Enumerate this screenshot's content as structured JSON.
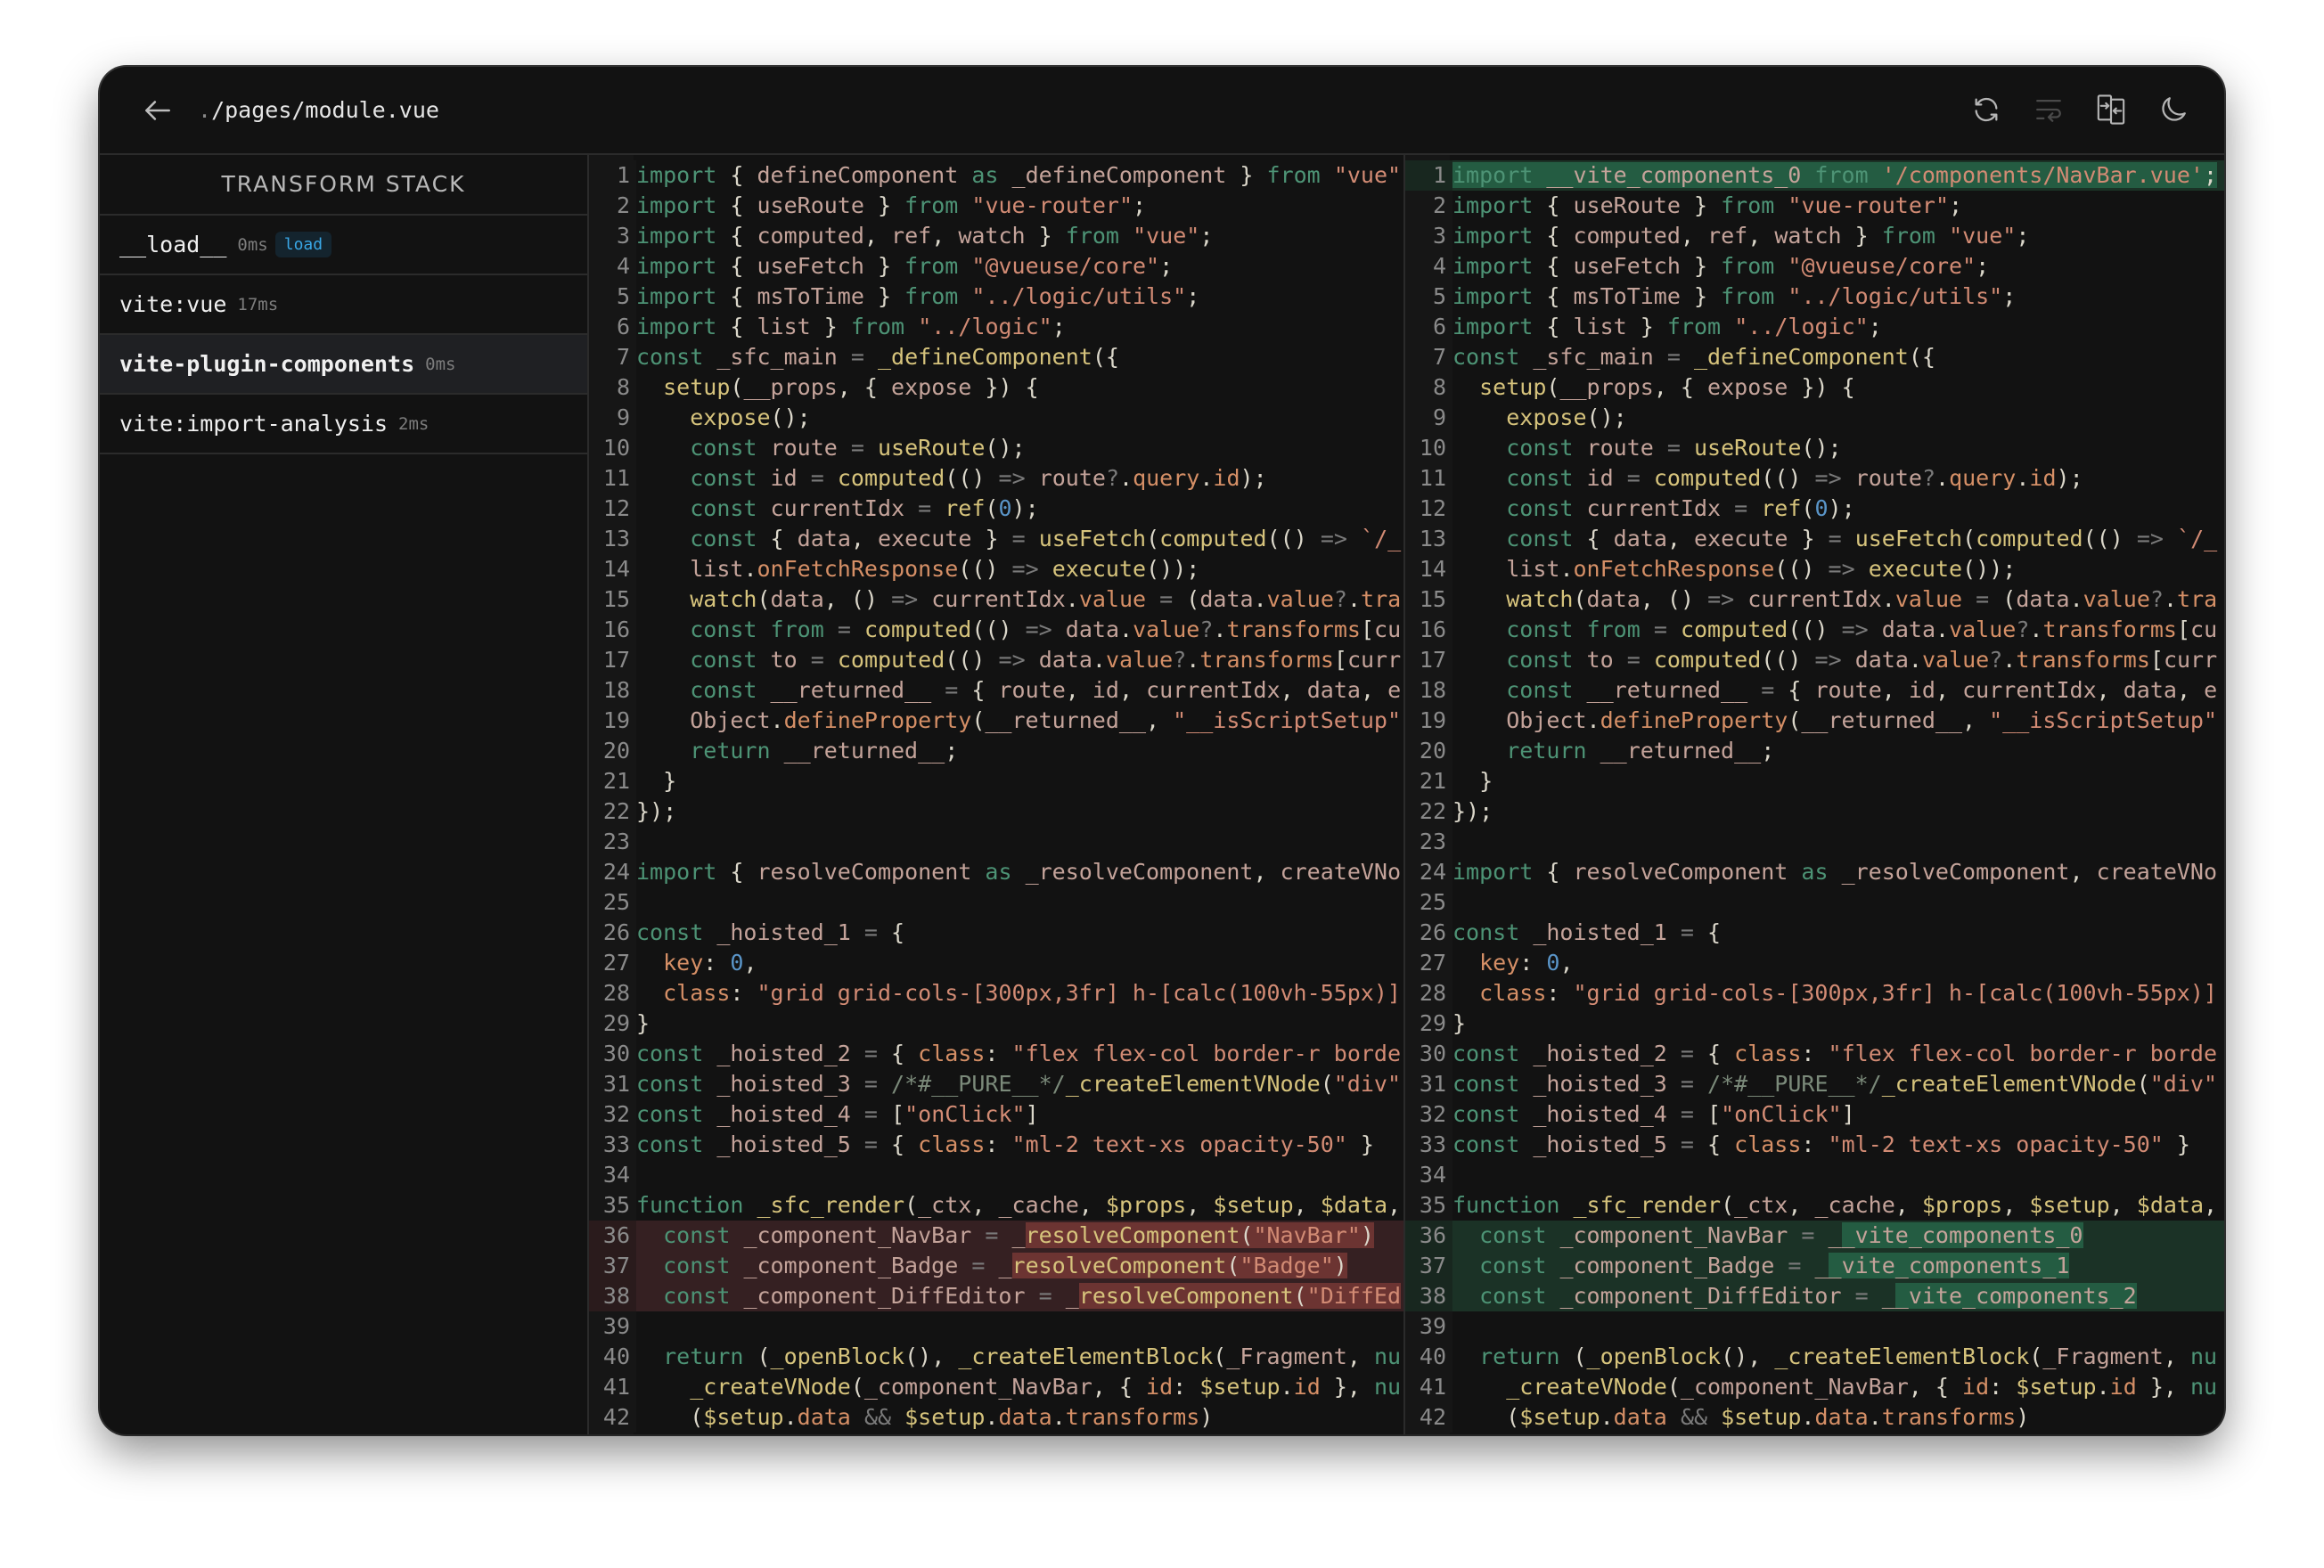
{
  "header": {
    "path_prefix": ".",
    "path": "/pages/module.vue",
    "icons": [
      "back-arrow-icon",
      "refresh-icon",
      "wrap-lines-icon",
      "split-diff-icon",
      "moon-icon"
    ]
  },
  "sidebar": {
    "title": "TRANSFORM STACK",
    "items": [
      {
        "name": "__load__",
        "time": "0ms",
        "badge": "load",
        "active": false
      },
      {
        "name": "vite:vue",
        "time": "17ms",
        "active": false
      },
      {
        "name": "vite-plugin-components",
        "time": "0ms",
        "active": true
      },
      {
        "name": "vite:import-analysis",
        "time": "2ms",
        "active": false
      }
    ]
  },
  "colors": {
    "added": "#245c42",
    "removed": "#6c3432",
    "badge": "#39a7e6",
    "background": "#121212"
  },
  "left": {
    "lines": [
      "import { defineComponent as _defineComponent } from \"vue\"",
      "import { useRoute } from \"vue-router\";",
      "import { computed, ref, watch } from \"vue\";",
      "import { useFetch } from \"@vueuse/core\";",
      "import { msToTime } from \"../logic/utils\";",
      "import { list } from \"../logic\";",
      "const _sfc_main = _defineComponent({",
      "  setup(__props, { expose }) {",
      "    expose();",
      "    const route = useRoute();",
      "    const id = computed(() => route?.query.id);",
      "    const currentIdx = ref(0);",
      "    const { data, execute } = useFetch(computed(() => `/_",
      "    list.onFetchResponse(() => execute());",
      "    watch(data, () => currentIdx.value = (data.value?.tra",
      "    const from = computed(() => data.value?.transforms[cu",
      "    const to = computed(() => data.value?.transforms[curr",
      "    const __returned__ = { route, id, currentIdx, data, e",
      "    Object.defineProperty(__returned__, \"__isScriptSetup\"",
      "    return __returned__;",
      "  }",
      "});",
      "",
      "import { resolveComponent as _resolveComponent, createVNo",
      "",
      "const _hoisted_1 = {",
      "  key: 0,",
      "  class: \"grid grid-cols-[300px,3fr] h-[calc(100vh-55px)]",
      "}",
      "const _hoisted_2 = { class: \"flex flex-col border-r borde",
      "const _hoisted_3 = /*#__PURE__*/_createElementVNode(\"div\"",
      "const _hoisted_4 = [\"onClick\"]",
      "const _hoisted_5 = { class: \"ml-2 text-xs opacity-50\" }",
      "",
      "function _sfc_render(_ctx, _cache, $props, $setup, $data,",
      {
        "text": "  const _component_NavBar = _resolveComponent(\"NavBar\")",
        "hl": "resolveComponent(\"NavBar\")",
        "diff": "removed"
      },
      {
        "text": "  const _component_Badge = _resolveComponent(\"Badge\")",
        "hl": "resolveComponent(\"Badge\")",
        "diff": "removed"
      },
      {
        "text": "  const _component_DiffEditor = _resolveComponent(\"DiffEd",
        "hl": "resolveComponent(\"DiffEd",
        "diff": "removed"
      },
      "",
      "  return (_openBlock(), _createElementBlock(_Fragment, nu",
      "    _createVNode(_component_NavBar, { id: $setup.id }, nu",
      "    ($setup.data && $setup.data.transforms)"
    ]
  },
  "right": {
    "lines": [
      {
        "text": "import __vite_components_0 from '/components/NavBar.vue';",
        "hl": "import __vite_components_0 from '/components/NavBar.vue';",
        "diff": "added"
      },
      "import { useRoute } from \"vue-router\";",
      "import { computed, ref, watch } from \"vue\";",
      "import { useFetch } from \"@vueuse/core\";",
      "import { msToTime } from \"../logic/utils\";",
      "import { list } from \"../logic\";",
      "const _sfc_main = _defineComponent({",
      "  setup(__props, { expose }) {",
      "    expose();",
      "    const route = useRoute();",
      "    const id = computed(() => route?.query.id);",
      "    const currentIdx = ref(0);",
      "    const { data, execute } = useFetch(computed(() => `/_",
      "    list.onFetchResponse(() => execute());",
      "    watch(data, () => currentIdx.value = (data.value?.tra",
      "    const from = computed(() => data.value?.transforms[cu",
      "    const to = computed(() => data.value?.transforms[curr",
      "    const __returned__ = { route, id, currentIdx, data, e",
      "    Object.defineProperty(__returned__, \"__isScriptSetup\"",
      "    return __returned__;",
      "  }",
      "});",
      "",
      "import { resolveComponent as _resolveComponent, createVNo",
      "",
      "const _hoisted_1 = {",
      "  key: 0,",
      "  class: \"grid grid-cols-[300px,3fr] h-[calc(100vh-55px)]",
      "}",
      "const _hoisted_2 = { class: \"flex flex-col border-r borde",
      "const _hoisted_3 = /*#__PURE__*/_createElementVNode(\"div\"",
      "const _hoisted_4 = [\"onClick\"]",
      "const _hoisted_5 = { class: \"ml-2 text-xs opacity-50\" }",
      "",
      "function _sfc_render(_ctx, _cache, $props, $setup, $data,",
      {
        "text": "  const _component_NavBar = __vite_components_0",
        "hl": "_vite_components_0",
        "diff": "added"
      },
      {
        "text": "  const _component_Badge = __vite_components_1",
        "hl": "_vite_components_1",
        "diff": "added"
      },
      {
        "text": "  const _component_DiffEditor = __vite_components_2",
        "hl": "_vite_components_2",
        "diff": "added"
      },
      "",
      "  return (_openBlock(), _createElementBlock(_Fragment, nu",
      "    _createVNode(_component_NavBar, { id: $setup.id }, nu",
      "    ($setup.data && $setup.data.transforms)"
    ]
  }
}
